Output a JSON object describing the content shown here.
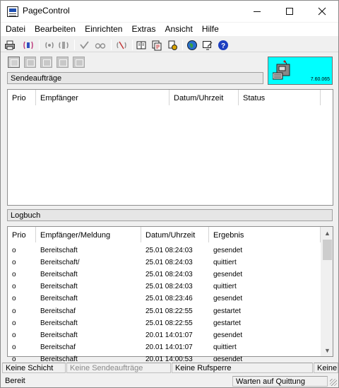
{
  "window": {
    "title": "PageControl"
  },
  "menu": [
    "Datei",
    "Bearbeiten",
    "Einrichten",
    "Extras",
    "Ansicht",
    "Hilfe"
  ],
  "toolbar_icons": [
    "print-icon",
    "radio-page-icon",
    "signal-icon",
    "transmit-icon",
    "antenna-check-icon",
    "glasses-icon",
    "antenna-off-icon",
    "book-icon",
    "pages-icon",
    "tools-icon",
    "globe-icon",
    "monitor-edit-icon",
    "help-icon"
  ],
  "device": {
    "version": "7.60.065",
    "bg_color": "#00ffff"
  },
  "sendeauftraege": {
    "header": "Sendeaufträge",
    "columns": [
      "Prio",
      "Empfänger",
      "Datum/Uhrzeit",
      "Status"
    ],
    "rows": []
  },
  "logbuch": {
    "header": "Logbuch",
    "columns": [
      "Prio",
      "Empfänger/Meldung",
      "Datum/Uhrzeit",
      "Ergebnis"
    ],
    "rows": [
      {
        "prio": "o",
        "empfaenger": "Bereitschaft",
        "datum": "25.01 08:24:03",
        "ergebnis": "gesendet"
      },
      {
        "prio": "o",
        "empfaenger": "Bereitschaft/",
        "datum": "25.01 08:24:03",
        "ergebnis": "quittiert"
      },
      {
        "prio": "o",
        "empfaenger": "Bereitschaft",
        "datum": "25.01 08:24:03",
        "ergebnis": "gesendet"
      },
      {
        "prio": "o",
        "empfaenger": "Bereitschaft",
        "datum": "25.01 08:24:03",
        "ergebnis": "quittiert"
      },
      {
        "prio": "o",
        "empfaenger": "Bereitschaft",
        "datum": "25.01 08:23:46",
        "ergebnis": "gesendet"
      },
      {
        "prio": "o",
        "empfaenger": "Bereitschaf",
        "datum": "25.01 08:22:55",
        "ergebnis": "gestartet"
      },
      {
        "prio": "o",
        "empfaenger": "Bereitschaft",
        "datum": "25.01 08:22:55",
        "ergebnis": "gestartet"
      },
      {
        "prio": "o",
        "empfaenger": "Bereitschaft",
        "datum": "20.01 14:01:07",
        "ergebnis": "gesendet"
      },
      {
        "prio": "o",
        "empfaenger": "Bereitschaf",
        "datum": "20.01 14:01:07",
        "ergebnis": "quittiert"
      },
      {
        "prio": "o",
        "empfaenger": "Bereitschaft",
        "datum": "20.01 14:00:53",
        "ergebnis": "gesendet"
      }
    ]
  },
  "status": {
    "schicht": "Keine Schicht",
    "sendeauftraege": "Keine Sendeaufträge",
    "rufsperre": "Keine Rufsperre",
    "extra": "Keine",
    "bereit": "Bereit",
    "quittung": "Warten auf Quittung"
  }
}
